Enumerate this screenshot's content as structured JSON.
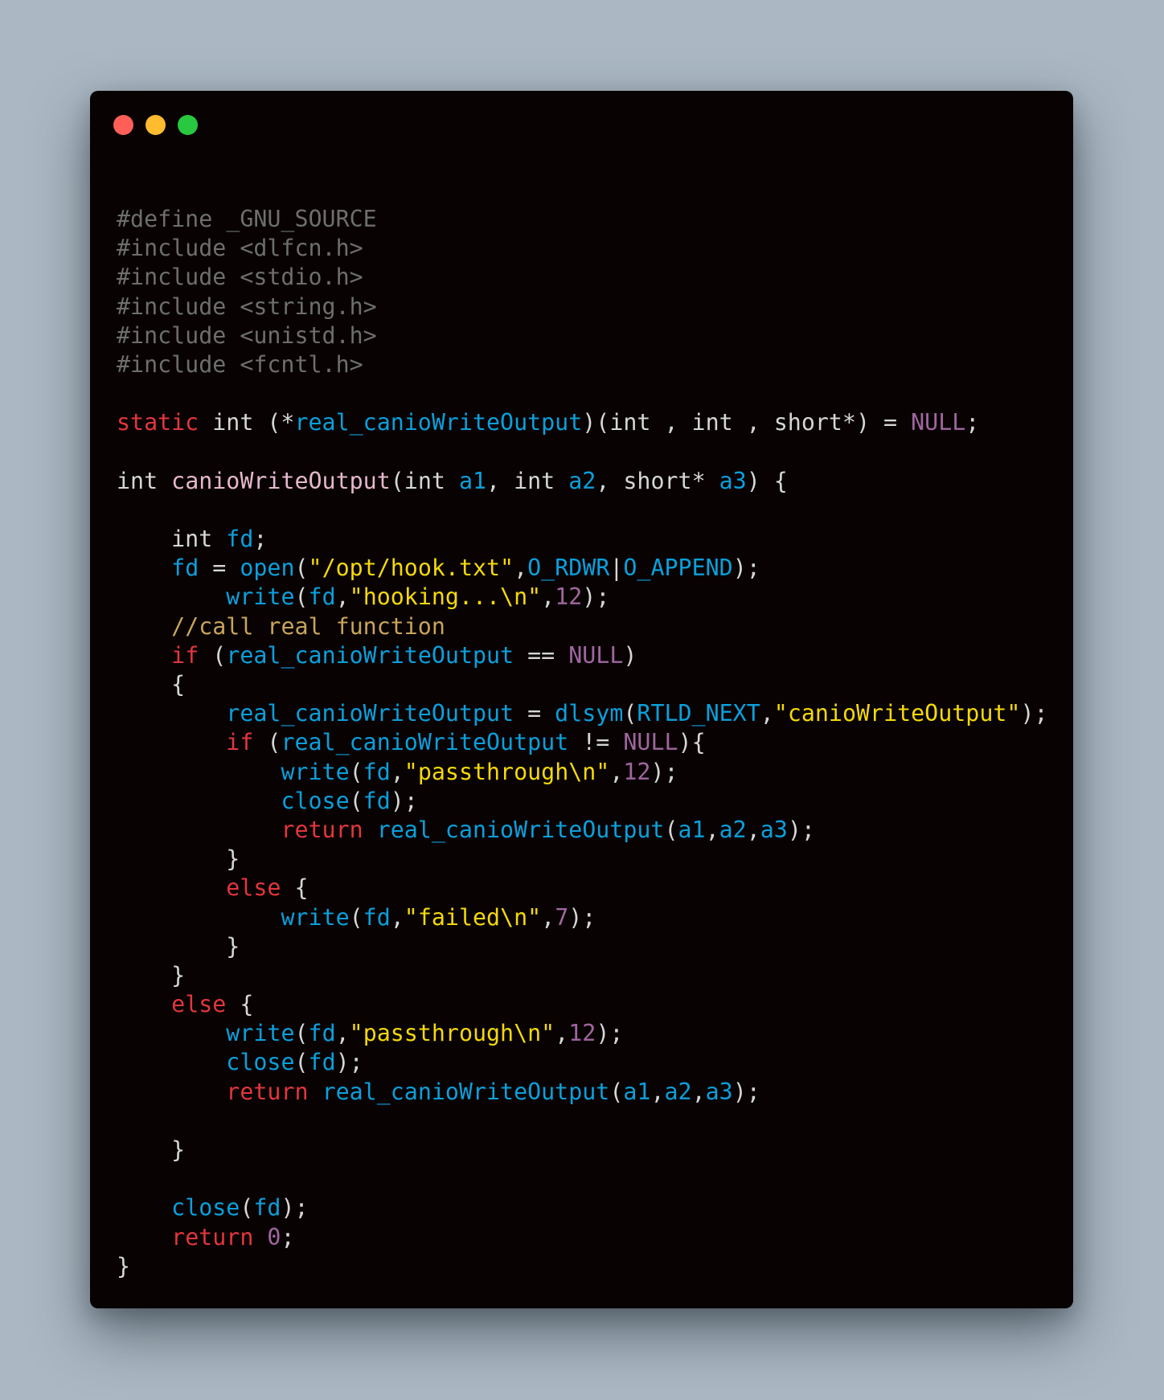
{
  "window": {
    "controls": [
      {
        "name": "close-button",
        "color": "#ff5f57"
      },
      {
        "name": "minimize-button",
        "color": "#febc2e"
      },
      {
        "name": "maximize-button",
        "color": "#28c840"
      }
    ]
  },
  "colors": {
    "background": "#abb8c3",
    "window": "#080202",
    "preproc": "#6e6e6e",
    "keyword": "#e2363c",
    "identifier": "#0aa0dc",
    "function_decl": "#e6b8cc",
    "string": "#f5d90a",
    "number": "#a066a0",
    "comment": "#c9a45c",
    "plain": "#d6d6d6"
  },
  "code": {
    "language": "c",
    "lines": [
      [
        [
          "preproc",
          "#define _GNU_SOURCE"
        ]
      ],
      [
        [
          "preproc",
          "#include <dlfcn.h>"
        ]
      ],
      [
        [
          "preproc",
          "#include <stdio.h>"
        ]
      ],
      [
        [
          "preproc",
          "#include <string.h>"
        ]
      ],
      [
        [
          "preproc",
          "#include <unistd.h>"
        ]
      ],
      [
        [
          "preproc",
          "#include <fcntl.h>"
        ]
      ],
      [],
      [
        [
          "keyword",
          "static"
        ],
        [
          "plain",
          " int (*"
        ],
        [
          "ident",
          "real_canioWriteOutput"
        ],
        [
          "plain",
          ")(int , int , short*) = "
        ],
        [
          "null",
          "NULL"
        ],
        [
          "plain",
          ";"
        ]
      ],
      [],
      [
        [
          "plain",
          "int "
        ],
        [
          "func-decl",
          "canioWriteOutput"
        ],
        [
          "plain",
          "(int "
        ],
        [
          "ident",
          "a1"
        ],
        [
          "plain",
          ", int "
        ],
        [
          "ident",
          "a2"
        ],
        [
          "plain",
          ", short* "
        ],
        [
          "ident",
          "a3"
        ],
        [
          "plain",
          ") {"
        ]
      ],
      [],
      [
        [
          "plain",
          "    int "
        ],
        [
          "ident",
          "fd"
        ],
        [
          "plain",
          ";"
        ]
      ],
      [
        [
          "plain",
          "    "
        ],
        [
          "ident",
          "fd"
        ],
        [
          "plain",
          " = "
        ],
        [
          "ident",
          "open"
        ],
        [
          "plain",
          "("
        ],
        [
          "string",
          "\"/opt/hook.txt\""
        ],
        [
          "plain",
          ","
        ],
        [
          "ident",
          "O_RDWR"
        ],
        [
          "plain",
          "|"
        ],
        [
          "ident",
          "O_APPEND"
        ],
        [
          "plain",
          ");"
        ]
      ],
      [
        [
          "plain",
          "        "
        ],
        [
          "ident",
          "write"
        ],
        [
          "plain",
          "("
        ],
        [
          "ident",
          "fd"
        ],
        [
          "plain",
          ","
        ],
        [
          "string",
          "\"hooking...\\n\""
        ],
        [
          "plain",
          ","
        ],
        [
          "number",
          "12"
        ],
        [
          "plain",
          ");"
        ]
      ],
      [
        [
          "plain",
          "    "
        ],
        [
          "comment",
          "//call real function"
        ]
      ],
      [
        [
          "plain",
          "    "
        ],
        [
          "keyword",
          "if"
        ],
        [
          "plain",
          " ("
        ],
        [
          "ident",
          "real_canioWriteOutput"
        ],
        [
          "plain",
          " == "
        ],
        [
          "null",
          "NULL"
        ],
        [
          "plain",
          ")"
        ]
      ],
      [
        [
          "plain",
          "    {"
        ]
      ],
      [
        [
          "plain",
          "        "
        ],
        [
          "ident",
          "real_canioWriteOutput"
        ],
        [
          "plain",
          " = "
        ],
        [
          "ident",
          "dlsym"
        ],
        [
          "plain",
          "("
        ],
        [
          "ident",
          "RTLD_NEXT"
        ],
        [
          "plain",
          ","
        ],
        [
          "string",
          "\"canioWriteOutput\""
        ],
        [
          "plain",
          ");"
        ]
      ],
      [
        [
          "plain",
          "        "
        ],
        [
          "keyword",
          "if"
        ],
        [
          "plain",
          " ("
        ],
        [
          "ident",
          "real_canioWriteOutput"
        ],
        [
          "plain",
          " != "
        ],
        [
          "null",
          "NULL"
        ],
        [
          "plain",
          "){"
        ]
      ],
      [
        [
          "plain",
          "            "
        ],
        [
          "ident",
          "write"
        ],
        [
          "plain",
          "("
        ],
        [
          "ident",
          "fd"
        ],
        [
          "plain",
          ","
        ],
        [
          "string",
          "\"passthrough\\n\""
        ],
        [
          "plain",
          ","
        ],
        [
          "number",
          "12"
        ],
        [
          "plain",
          ");"
        ]
      ],
      [
        [
          "plain",
          "            "
        ],
        [
          "ident",
          "close"
        ],
        [
          "plain",
          "("
        ],
        [
          "ident",
          "fd"
        ],
        [
          "plain",
          ");"
        ]
      ],
      [
        [
          "plain",
          "            "
        ],
        [
          "keyword",
          "return"
        ],
        [
          "plain",
          " "
        ],
        [
          "ident",
          "real_canioWriteOutput"
        ],
        [
          "plain",
          "("
        ],
        [
          "ident",
          "a1"
        ],
        [
          "plain",
          ","
        ],
        [
          "ident",
          "a2"
        ],
        [
          "plain",
          ","
        ],
        [
          "ident",
          "a3"
        ],
        [
          "plain",
          ");"
        ]
      ],
      [
        [
          "plain",
          "        }"
        ]
      ],
      [
        [
          "plain",
          "        "
        ],
        [
          "keyword",
          "else"
        ],
        [
          "plain",
          " {"
        ]
      ],
      [
        [
          "plain",
          "            "
        ],
        [
          "ident",
          "write"
        ],
        [
          "plain",
          "("
        ],
        [
          "ident",
          "fd"
        ],
        [
          "plain",
          ","
        ],
        [
          "string",
          "\"failed\\n\""
        ],
        [
          "plain",
          ","
        ],
        [
          "number",
          "7"
        ],
        [
          "plain",
          ");"
        ]
      ],
      [
        [
          "plain",
          "        }"
        ]
      ],
      [
        [
          "plain",
          "    }"
        ]
      ],
      [
        [
          "plain",
          "    "
        ],
        [
          "keyword",
          "else"
        ],
        [
          "plain",
          " {"
        ]
      ],
      [
        [
          "plain",
          "        "
        ],
        [
          "ident",
          "write"
        ],
        [
          "plain",
          "("
        ],
        [
          "ident",
          "fd"
        ],
        [
          "plain",
          ","
        ],
        [
          "string",
          "\"passthrough\\n\""
        ],
        [
          "plain",
          ","
        ],
        [
          "number",
          "12"
        ],
        [
          "plain",
          ");"
        ]
      ],
      [
        [
          "plain",
          "        "
        ],
        [
          "ident",
          "close"
        ],
        [
          "plain",
          "("
        ],
        [
          "ident",
          "fd"
        ],
        [
          "plain",
          ");"
        ]
      ],
      [
        [
          "plain",
          "        "
        ],
        [
          "keyword",
          "return"
        ],
        [
          "plain",
          " "
        ],
        [
          "ident",
          "real_canioWriteOutput"
        ],
        [
          "plain",
          "("
        ],
        [
          "ident",
          "a1"
        ],
        [
          "plain",
          ","
        ],
        [
          "ident",
          "a2"
        ],
        [
          "plain",
          ","
        ],
        [
          "ident",
          "a3"
        ],
        [
          "plain",
          ");"
        ]
      ],
      [],
      [
        [
          "plain",
          "    }"
        ]
      ],
      [],
      [
        [
          "plain",
          "    "
        ],
        [
          "ident",
          "close"
        ],
        [
          "plain",
          "("
        ],
        [
          "ident",
          "fd"
        ],
        [
          "plain",
          ");"
        ]
      ],
      [
        [
          "plain",
          "    "
        ],
        [
          "keyword",
          "return"
        ],
        [
          "plain",
          " "
        ],
        [
          "number",
          "0"
        ],
        [
          "plain",
          ";"
        ]
      ],
      [
        [
          "plain",
          "}"
        ]
      ]
    ]
  }
}
